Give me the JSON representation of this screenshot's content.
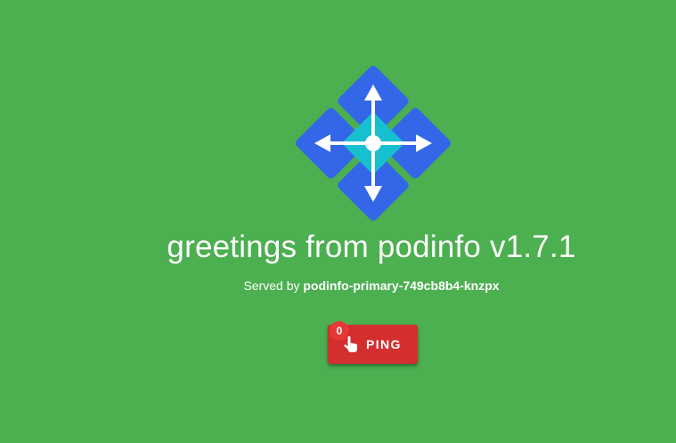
{
  "app": {
    "title": "greetings from podinfo v1.7.1",
    "served_prefix": "Served by",
    "pod_name": "podinfo-primary-749cb8b4-knzpx"
  },
  "ping": {
    "label": "PING",
    "count": "0"
  },
  "icons": {
    "logo": "podinfo-logo-icon",
    "hand": "pointing-hand-icon"
  },
  "colors": {
    "background": "#4caf50",
    "logo_blue": "#3367e8",
    "logo_center": "#18bfcf",
    "button": "#d32f2f",
    "badge": "#e53935"
  }
}
